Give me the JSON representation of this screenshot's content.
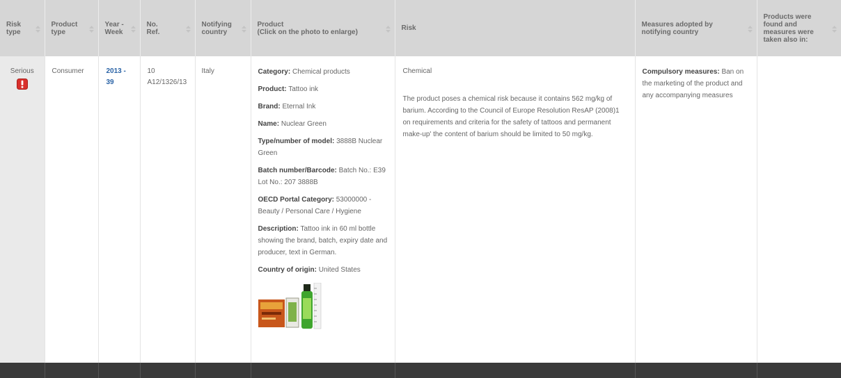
{
  "table": {
    "headers": [
      {
        "id": "risk-type",
        "line1": "Risk",
        "line2": "type"
      },
      {
        "id": "product-type",
        "line1": "Product",
        "line2": "type"
      },
      {
        "id": "year-week",
        "line1": "Year -",
        "line2": "Week"
      },
      {
        "id": "ref",
        "line1": "No.",
        "line2": "Ref."
      },
      {
        "id": "notifying-country",
        "line1": "Notifying",
        "line2": "country"
      },
      {
        "id": "product",
        "line1": "Product",
        "line2": "(Click on the photo to enlarge)"
      },
      {
        "id": "risk",
        "line1": "Risk",
        "line2": ""
      },
      {
        "id": "measures",
        "line1": "Measures adopted by",
        "line2": "notifying country"
      },
      {
        "id": "found-also",
        "line1": "Products were",
        "line2": "found and",
        "line3": "measures were",
        "line4": "taken also in:"
      }
    ],
    "row": {
      "risk_type": "Serious",
      "product_type": "Consumer",
      "year_week_line1": "2013 -",
      "year_week_line2": "39",
      "ref_line1": "10",
      "ref_line2": "A12/1326/13",
      "notifying_country": "Italy",
      "product": {
        "category_label": "Category:",
        "category": "Chemical products",
        "product_label": "Product:",
        "product": "Tattoo ink",
        "brand_label": "Brand:",
        "brand": "Eternal Ink",
        "name_label": "Name:",
        "name": "Nuclear Green",
        "model_label": "Type/number of model:",
        "model": "3888B Nuclear Green",
        "batch_label": "Batch number/Barcode:",
        "batch": "Batch No.: E39 Lot No.: 207 3888B",
        "oecd_label": "OECD Portal Category:",
        "oecd": "53000000 - Beauty / Personal Care / Hygiene",
        "description_label": "Description:",
        "description": "Tattoo ink in 60 ml bottle showing the brand, batch, expiry date and producer, text in German.",
        "origin_label": "Country of origin:",
        "origin": "United States"
      },
      "risk_title": "Chemical",
      "risk_text": "The product poses a chemical risk because it contains 562 mg/kg of barium. According to the Council of Europe Resolution ResAP (2008)1 on requirements and criteria for the safety of tattoos and permanent make-up' the content of barium should be limited to 50 mg/kg.",
      "measures_label": "Compulsory measures:",
      "measures": "Ban on the marketing of the product and any accompanying measures",
      "found_also": ""
    }
  },
  "icons": {
    "serious_alert": "exclamation-alert-icon",
    "sort": "sort-arrows-icon"
  },
  "colors": {
    "header_bg": "#d6d6d6",
    "risk_col_bg": "#eaeaea",
    "link_blue": "#2a63a6",
    "alert_red": "#d9302c",
    "footer_bar": "#3a3a3a"
  }
}
